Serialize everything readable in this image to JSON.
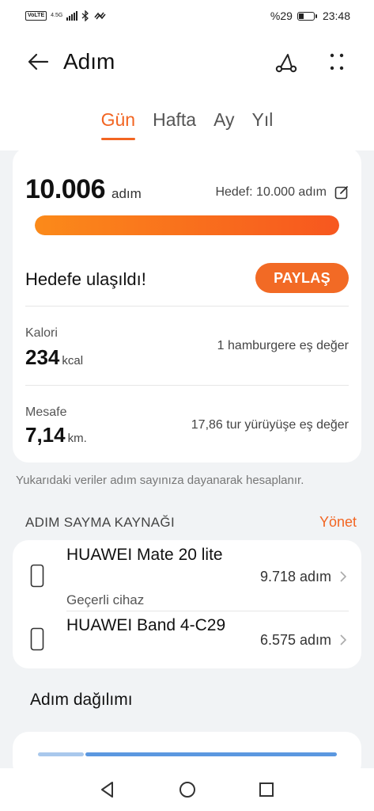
{
  "status_bar": {
    "network_badge": "VoLTE",
    "network_type": "4.5G",
    "battery_text": "%29",
    "time": "23:48",
    "battery_level": 0.29
  },
  "header": {
    "title": "Adım",
    "icons": [
      "back-arrow-icon",
      "route-icon",
      "more-icon"
    ]
  },
  "tabs": [
    {
      "label": "Gün",
      "active": true
    },
    {
      "label": "Hafta",
      "active": false
    },
    {
      "label": "Ay",
      "active": false
    },
    {
      "label": "Yıl",
      "active": false
    }
  ],
  "summary": {
    "steps_value": "10.006",
    "steps_unit": "adım",
    "goal_text": "Hedef: 10.000 adım",
    "progress": 1.0,
    "achieved_text": "Hedefe ulaşıldı!",
    "share_label": "PAYLAŞ",
    "calories": {
      "label": "Kalori",
      "value": "234",
      "unit": "kcal",
      "equivalent": "1 hamburgere eş değer"
    },
    "distance": {
      "label": "Mesafe",
      "value": "7,14",
      "unit": "km.",
      "equivalent": "17,86 tur yürüyüşe eş değer"
    }
  },
  "note": "Yukarıdaki veriler adım sayınıza dayanarak hesaplanır.",
  "source_section": {
    "title": "ADIM SAYMA KAYNAĞI",
    "manage_label": "Yönet",
    "devices": [
      {
        "name": "HUAWEI Mate 20 lite",
        "subtitle": "Geçerli cihaz",
        "steps": "9.718 adım"
      },
      {
        "name": "HUAWEI Band 4-C29",
        "subtitle": "",
        "steps": "6.575 adım"
      }
    ]
  },
  "distribution": {
    "title": "Adım dağılımı"
  },
  "colors": {
    "accent": "#f26522",
    "progress_start": "#fb8a1a",
    "progress_end": "#f7571f",
    "background": "#f1f3f5",
    "dist_light": "#a9c8ec",
    "dist_dark": "#5b98e0"
  }
}
